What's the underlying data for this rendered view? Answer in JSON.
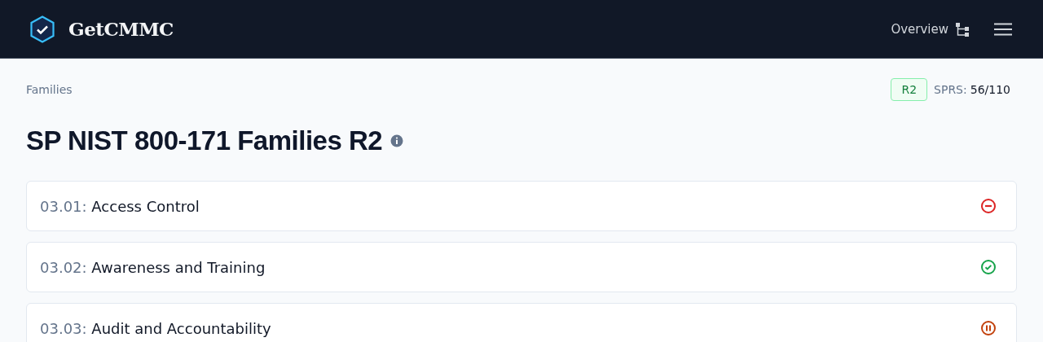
{
  "header": {
    "brand": "GetCMMC",
    "nav_link": "Overview"
  },
  "breadcrumb": "Families",
  "revision_badge": "R2",
  "sprs": {
    "label": "SPRS:",
    "value": "56/110"
  },
  "title": "SP NIST 800-171 Families R2",
  "families": [
    {
      "code": "03.01:",
      "name": "Access Control",
      "kind": "not-met"
    },
    {
      "code": "03.02:",
      "name": "Awareness and Training",
      "kind": "met"
    },
    {
      "code": "03.03:",
      "name": "Audit and Accountability",
      "kind": "in-progress"
    }
  ]
}
